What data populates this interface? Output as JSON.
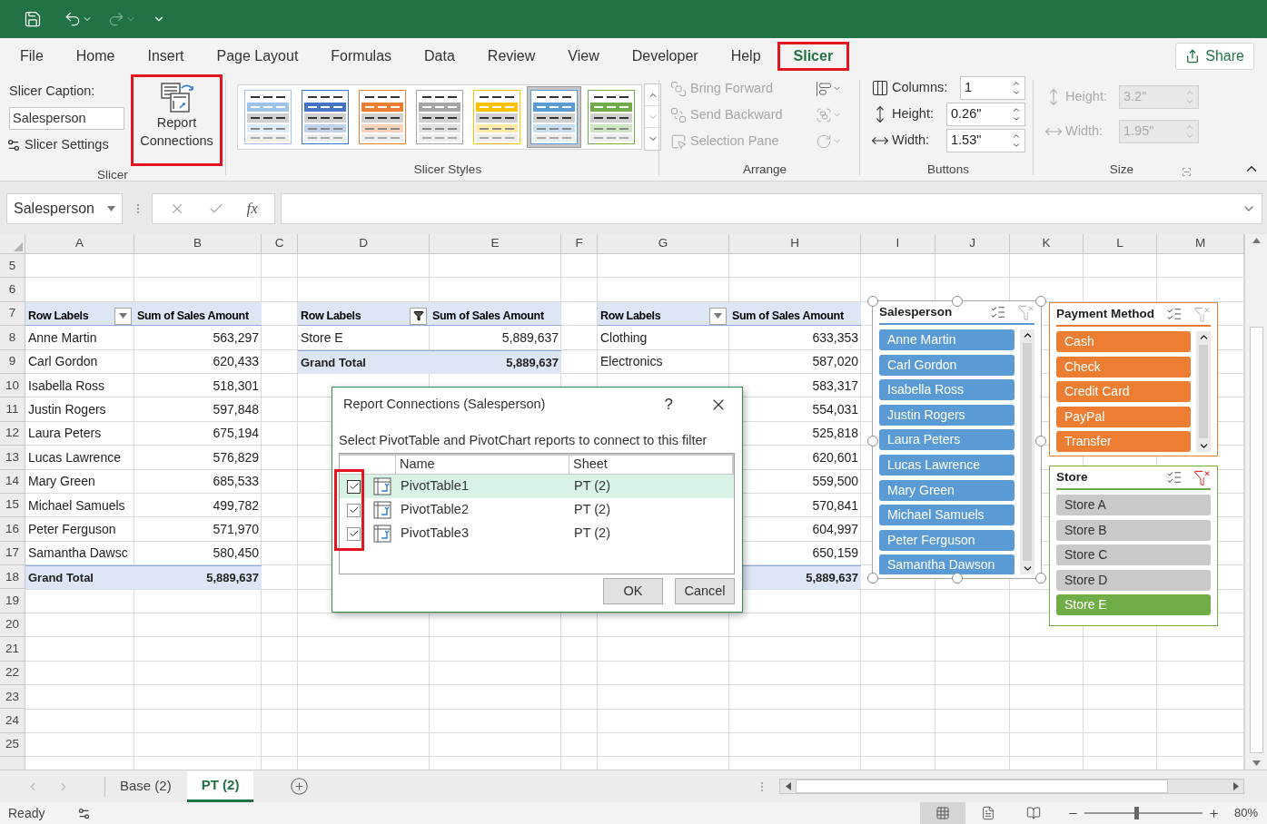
{
  "menu_tabs": [
    {
      "label": "File",
      "selected": false,
      "highlighted": false
    },
    {
      "label": "Home",
      "selected": false,
      "highlighted": false
    },
    {
      "label": "Insert",
      "selected": false,
      "highlighted": false
    },
    {
      "label": "Page Layout",
      "selected": false,
      "highlighted": false
    },
    {
      "label": "Formulas",
      "selected": false,
      "highlighted": false
    },
    {
      "label": "Data",
      "selected": false,
      "highlighted": false
    },
    {
      "label": "Review",
      "selected": false,
      "highlighted": false
    },
    {
      "label": "View",
      "selected": false,
      "highlighted": false
    },
    {
      "label": "Developer",
      "selected": false,
      "highlighted": false
    },
    {
      "label": "Help",
      "selected": false,
      "highlighted": false
    },
    {
      "label": "Slicer",
      "selected": true,
      "highlighted": true
    }
  ],
  "share_button": "Share",
  "ribbon": {
    "slicer_group": {
      "caption_label": "Slicer Caption:",
      "caption_value": "Salesperson",
      "settings_button": "Slicer Settings",
      "report_connections": {
        "label": "Report Connections",
        "highlighted": true
      },
      "label": "Slicer"
    },
    "styles": {
      "label": "Slicer Styles",
      "items": [
        {
          "color": "#9dc3e6",
          "selected": false
        },
        {
          "color": "#4472c4",
          "selected": false
        },
        {
          "color": "#ed7d31",
          "selected": false
        },
        {
          "color": "#a5a5a5",
          "selected": false
        },
        {
          "color": "#ffc000",
          "selected": false
        },
        {
          "color": "#5b9bd5",
          "selected": true
        },
        {
          "color": "#70ad47",
          "selected": false
        }
      ]
    },
    "arrange": {
      "label": "Arrange",
      "commands": [
        {
          "label": "Bring Forward",
          "disabled": true
        },
        {
          "label": "Send Backward",
          "disabled": true
        },
        {
          "label": "Selection Pane",
          "disabled": true
        }
      ]
    },
    "buttons": {
      "label": "Buttons",
      "fields": [
        {
          "label": "Columns:",
          "value": "1",
          "disabled": false
        },
        {
          "label": "Height:",
          "value": "0.26\"",
          "disabled": false
        },
        {
          "label": "Width:",
          "value": "1.53\"",
          "disabled": false
        }
      ]
    },
    "size": {
      "label": "Size",
      "fields": [
        {
          "label": "Height:",
          "value": "3.2\"",
          "disabled": true
        },
        {
          "label": "Width:",
          "value": "1.95\"",
          "disabled": true
        }
      ]
    }
  },
  "name_box": "Salesperson",
  "function_label": "fx",
  "sheet": {
    "columns": [
      "A",
      "B",
      "C",
      "D",
      "E",
      "F",
      "G",
      "H",
      "I",
      "J",
      "K",
      "L",
      "M"
    ],
    "rows": [
      "5",
      "6",
      "7",
      "8",
      "9",
      "10",
      "11",
      "12",
      "13",
      "14",
      "15",
      "16",
      "17",
      "18",
      "19",
      "20",
      "21",
      "22",
      "23",
      "24",
      "25"
    ]
  },
  "pivot_tables": [
    {
      "columns": [
        "Row Labels",
        "Sum of Sales Amount"
      ],
      "filtered": false,
      "rows": [
        {
          "label": "Anne Martin",
          "value": "563,297"
        },
        {
          "label": "Carl Gordon",
          "value": "620,433"
        },
        {
          "label": "Isabella Ross",
          "value": "518,301"
        },
        {
          "label": "Justin Rogers",
          "value": "597,848"
        },
        {
          "label": "Laura Peters",
          "value": "675,194"
        },
        {
          "label": "Lucas Lawrence",
          "value": "576,829"
        },
        {
          "label": "Mary Green",
          "value": "685,533"
        },
        {
          "label": "Michael Samuels",
          "value": "499,782"
        },
        {
          "label": "Peter Ferguson",
          "value": "571,970"
        },
        {
          "label": "Samantha Dawsc",
          "value": "580,450"
        }
      ],
      "total": {
        "label": "Grand Total",
        "value": "5,889,637"
      }
    },
    {
      "columns": [
        "Row Labels",
        "Sum of Sales Amount"
      ],
      "filtered": true,
      "rows": [
        {
          "label": "Store E",
          "value": "5,889,637"
        }
      ],
      "total": {
        "label": "Grand Total",
        "value": "5,889,637"
      }
    },
    {
      "columns": [
        "Row Labels",
        "Sum of Sales Amount"
      ],
      "filtered": false,
      "rows": [
        {
          "label": "Clothing",
          "value": "633,353"
        },
        {
          "label": "Electronics",
          "value": "587,020"
        },
        {
          "value": "583,317"
        },
        {
          "value": "554,031"
        },
        {
          "value": "525,818"
        },
        {
          "value": "620,601"
        },
        {
          "value": "559,500"
        },
        {
          "value": "570,841"
        },
        {
          "value": "604,997"
        },
        {
          "value": "650,159"
        }
      ],
      "total": {
        "value": "5,889,637"
      }
    }
  ],
  "dialog": {
    "title": "Report Connections (Salesperson)",
    "help": "?",
    "instruction": "Select PivotTable and PivotChart reports to connect to this filter",
    "columns": [
      "Name",
      "Sheet"
    ],
    "checkboxes_highlighted": true,
    "rows": [
      {
        "name": "PivotTable1",
        "sheet": "PT (2)",
        "checked": true,
        "selected": true
      },
      {
        "name": "PivotTable2",
        "sheet": "PT (2)",
        "checked": true,
        "selected": false
      },
      {
        "name": "PivotTable3",
        "sheet": "PT (2)",
        "checked": true,
        "selected": false
      }
    ],
    "buttons": [
      "OK",
      "Cancel"
    ]
  },
  "slicers": [
    {
      "title": "Salesperson",
      "color": "#5b9bd5",
      "active": true,
      "filtered": false,
      "scrollbar": true,
      "items": [
        {
          "label": "Anne Martin",
          "selected": true
        },
        {
          "label": "Carl Gordon",
          "selected": true
        },
        {
          "label": "Isabella Ross",
          "selected": true
        },
        {
          "label": "Justin Rogers",
          "selected": true
        },
        {
          "label": "Laura Peters",
          "selected": true
        },
        {
          "label": "Lucas Lawrence",
          "selected": true
        },
        {
          "label": "Mary Green",
          "selected": true
        },
        {
          "label": "Michael Samuels",
          "selected": true
        },
        {
          "label": "Peter Ferguson",
          "selected": true
        },
        {
          "label": "Samantha Dawson",
          "selected": true
        }
      ]
    },
    {
      "title": "Payment Method",
      "color": "#ed7d31",
      "active": false,
      "filtered": false,
      "scrollbar": true,
      "items": [
        {
          "label": "Cash",
          "selected": true
        },
        {
          "label": "Check",
          "selected": true
        },
        {
          "label": "Credit Card",
          "selected": true
        },
        {
          "label": "PayPal",
          "selected": true
        },
        {
          "label": "Transfer",
          "selected": true
        }
      ]
    },
    {
      "title": "Store",
      "color": "#70ad47",
      "active": false,
      "filtered": true,
      "scrollbar": false,
      "items": [
        {
          "label": "Store A",
          "selected": false
        },
        {
          "label": "Store B",
          "selected": false
        },
        {
          "label": "Store C",
          "selected": false
        },
        {
          "label": "Store D",
          "selected": false
        },
        {
          "label": "Store E",
          "selected": true
        }
      ]
    }
  ],
  "sheet_tabs": [
    {
      "label": "Base (2)",
      "selected": false
    },
    {
      "label": "PT (2)",
      "selected": true
    }
  ],
  "status_bar": {
    "text": "Ready",
    "views": [
      {
        "kind": "normal",
        "selected": true
      },
      {
        "kind": "page_layout",
        "selected": false
      },
      {
        "kind": "page_break",
        "selected": false
      }
    ],
    "zoom_slider": {
      "level": 0.42
    },
    "zoom": "80%"
  }
}
